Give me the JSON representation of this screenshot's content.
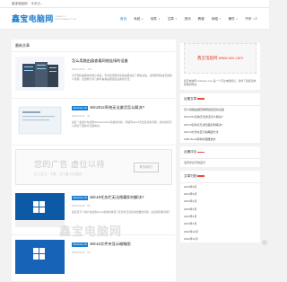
{
  "topbar": {
    "items": [
      "鑫宝电脑网",
      "今天已..."
    ]
  },
  "header": {
    "logo_title": "鑫宝电脑网",
    "logo_sub_1": "XINBAO PC",
    "logo_sub_2": "WWW.XINBAOPC.COM",
    "nav": [
      {
        "label": "首页",
        "active": true,
        "dropdown": false
      },
      {
        "label": "系统",
        "active": false,
        "dropdown": true
      },
      {
        "label": "软件",
        "active": false,
        "dropdown": true
      },
      {
        "label": "文章",
        "active": false,
        "dropdown": true
      },
      {
        "label": "资讯",
        "active": false,
        "dropdown": false
      },
      {
        "label": "教程",
        "active": false,
        "dropdown": false
      },
      {
        "label": "网络",
        "active": false,
        "dropdown": true
      },
      {
        "label": "硬件",
        "active": false,
        "dropdown": true
      },
      {
        "label": "汽车",
        "active": false,
        "dropdown": true
      }
    ]
  },
  "main": {
    "section_title": "最新文章",
    "articles": [
      {
        "tag": "",
        "title": "怎么用路由器查看网络连接的设备",
        "date": "2023-06-09",
        "views": "123",
        "likes": "0",
        "desc": "对于刚接触网络的用户来说，有时候需要查看路由器连接了哪些设备，来判断网络是否被别人蹭用，这里教大家几种查看路由器连接设备的方法。",
        "thumb": "servers"
      },
      {
        "tag": "Windows 10",
        "title": "Win2012系统无法激活怎么解决?",
        "date": "2023-06-02",
        "views": "97",
        "likes": "0",
        "desc": "最近一些用户在使用Windows2012系统的时候，却遇到win10无法激活的问题，这时候就可以通过下面的方法来解决。",
        "thumb": "screen"
      },
      {
        "tag": "Windows 10",
        "title": "Win10任务栏无法隐藏如何解决?",
        "date": "2023-05-28",
        "views": "84",
        "likes": "0",
        "desc": "最近有不少用户在使用win10系统时遇到了任务栏无法自动隐藏的问题，这该如何解决呢？",
        "thumb": "win"
      },
      {
        "tag": "Windows 10",
        "title": "Win10文件夹显示缩略图",
        "date": "2023-05-21",
        "views": "66",
        "likes": "0",
        "desc": "",
        "thumb": "win"
      }
    ],
    "ad": {
      "title": "您的广告 虚位以待",
      "sub": "打工百万、千里、万人看 打次成交",
      "button": "联系我们"
    }
  },
  "side": {
    "promo_text": "鑫宝电脑网 www.xxx.com",
    "blurb": "鑫宝电脑网 xinbaopc.com 是一个专注电脑知识、软件下载和系统教程的网站。",
    "recent_title": "近期文章",
    "recent": [
      "怎么用路由器查看网络连接的设备",
      "Win2012系统无法激活怎么解决?",
      "Win10任务栏无法隐藏如何解决?",
      "Win10文件夹显示缩略图方法",
      "AMD Zen3架构处理器发布"
    ],
    "archive_title": "近期评论",
    "archive_empty": "没有评论可供显示",
    "dates_title": "文章归档",
    "dates": [
      "2023年6月",
      "2023年5月",
      "2023年4月",
      "2023年3月",
      "2023年2月",
      "2023年1月",
      "2022年12月",
      "2022年11月"
    ]
  },
  "watermark": "鑫宝电脑网"
}
